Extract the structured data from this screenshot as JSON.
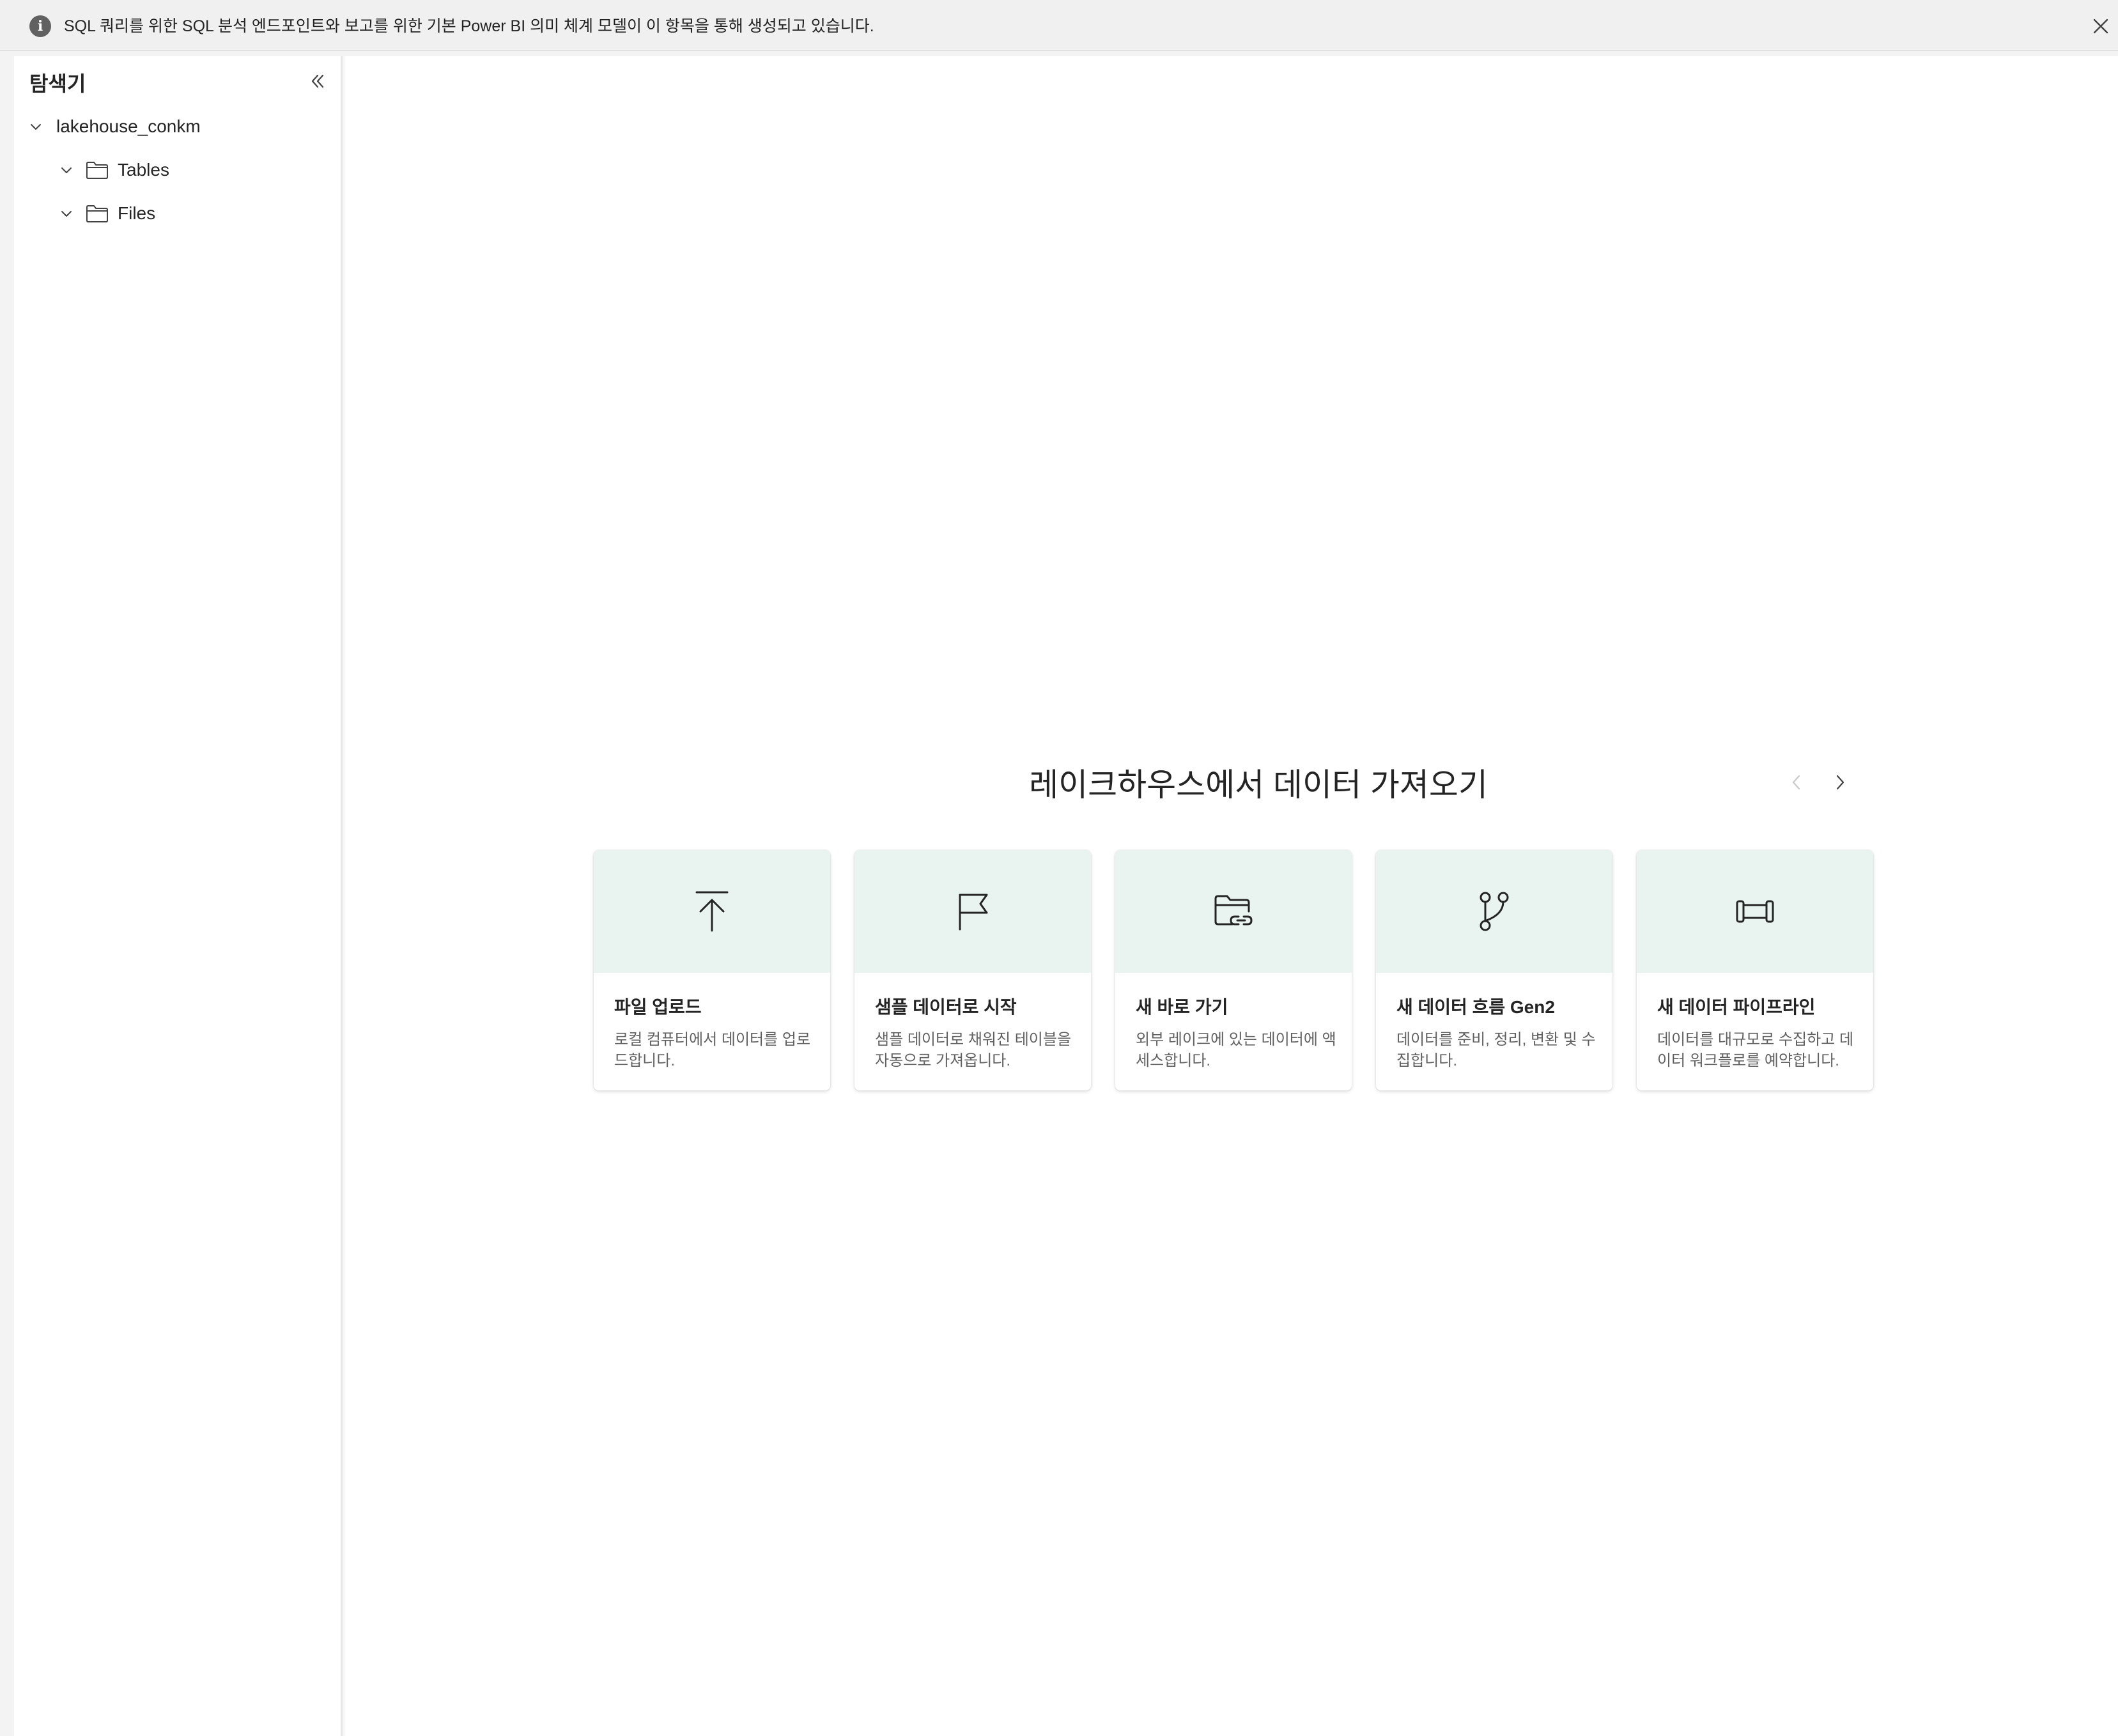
{
  "banner": {
    "message": "SQL 쿼리를 위한 SQL 분석 엔드포인트와 보고를 위한 기본 Power BI 의미 체계 모델이 이 항목을 통해 생성되고 있습니다.",
    "icon": "info-icon",
    "close_icon": "close-icon"
  },
  "explorer": {
    "title": "탐색기",
    "collapse_icon": "double-chevron-left-icon",
    "tree": {
      "root": {
        "label": "lakehouse_conkm",
        "icon": "chevron-down-icon"
      },
      "children": [
        {
          "label": "Tables",
          "icon": "folder-icon"
        },
        {
          "label": "Files",
          "icon": "folder-icon"
        }
      ]
    }
  },
  "main": {
    "heading": "레이크하우스에서 데이터 가져오기",
    "prev_icon": "chevron-left-icon",
    "next_icon": "chevron-right-icon",
    "cards": [
      {
        "title": "파일 업로드",
        "desc": "로컬 컴퓨터에서 데이터를 업로드합니다.",
        "icon": "upload-icon"
      },
      {
        "title": "샘플 데이터로 시작",
        "desc": "샘플 데이터로 채워진 테이블을 자동으로 가져옵니다.",
        "icon": "flag-icon"
      },
      {
        "title": "새 바로 가기",
        "desc": "외부 레이크에 있는 데이터에 액세스합니다.",
        "icon": "folder-link-icon"
      },
      {
        "title": "새 데이터 흐름 Gen2",
        "desc": "데이터를 준비, 정리, 변환 및 수집합니다.",
        "icon": "branch-icon"
      },
      {
        "title": "새 데이터 파이프라인",
        "desc": "데이터를 대규모로 수집하고 데이터 워크플로를 예약합니다.",
        "icon": "pipeline-icon"
      }
    ]
  },
  "colors": {
    "card_band": "#e9f3ef",
    "banner_bg": "#f0f0f0",
    "text_primary": "#242424",
    "text_secondary": "#616161"
  }
}
